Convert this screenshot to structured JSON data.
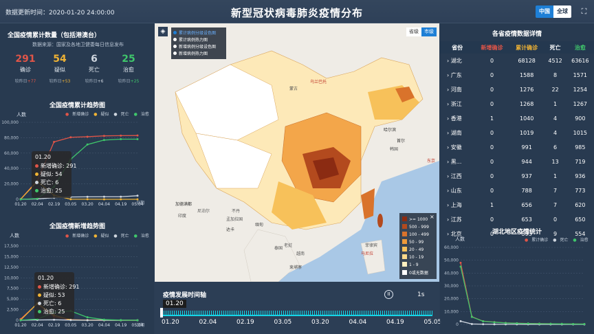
{
  "header": {
    "update_label": "数据更新时间：",
    "update_time": "2020-01-20 24:00:00",
    "title": "新型冠状病毒肺炎疫情分布",
    "btn_china": "中国",
    "btn_global": "全球",
    "colors": {
      "accent": "#1e7fd6"
    }
  },
  "left": {
    "summary_title": "全国疫情累计数量（包括港澳台）",
    "source": "数据来源：国家及各地卫健委每日信息发布",
    "stats": [
      {
        "value": "291",
        "label": "确诊",
        "delta_label": "较昨日",
        "delta": "+77",
        "color": "#e05548"
      },
      {
        "value": "54",
        "label": "疑似",
        "delta_label": "较昨日",
        "delta": "+53",
        "color": "#f0b334"
      },
      {
        "value": "6",
        "label": "死亡",
        "delta_label": "较昨日",
        "delta": "+6",
        "color": "#cfd6df"
      },
      {
        "value": "25",
        "label": "治愈",
        "delta_label": "较昨日",
        "delta": "+25",
        "color": "#3fc66b"
      }
    ],
    "trend1": {
      "title": "全国疫情累计趋势图",
      "ylabel": "人数",
      "xlabel": "日期"
    },
    "trend2": {
      "title": "全国疫情新增趋势图",
      "ylabel": "人数",
      "xlabel": "日期"
    },
    "legend": {
      "confirm": "新增确诊",
      "suspect": "疑似",
      "dead": "死亡",
      "cure": "治愈"
    },
    "tip1": {
      "date": "01.20",
      "confirm": "新增确诊: 291",
      "suspect": "疑似: 54",
      "dead": "死亡: 6",
      "cure": "治愈: 25"
    },
    "tip2": {
      "date": "01.20",
      "confirm": "新增确诊: 291",
      "suspect": "疑似: 53",
      "dead": "死亡: 6",
      "cure": "治愈: 25"
    }
  },
  "map": {
    "legend": [
      "累计病例分级设色图",
      "累计病例热力图",
      "新增病例分级设色图",
      "新增病例热力图"
    ],
    "btn_prov": "省级",
    "btn_city": "市级",
    "ranges": [
      ">= 1000",
      "500 - 999",
      "100 - 499",
      "50 - 99",
      "20 - 49",
      "10 - 19",
      "1 - 9",
      "0或无数据"
    ],
    "range_colors": [
      "#8b2b12",
      "#b34a1e",
      "#d9732b",
      "#ee9a3a",
      "#f7c15a",
      "#fbd98a",
      "#fdefc0",
      "#ffffff"
    ],
    "places": {
      "mongolia": "蒙古",
      "ulaanbaatar": "乌兰巴托",
      "korea": "韩国",
      "seoul": "首尔",
      "tokyo": "东京",
      "nepal": "尼泊尔",
      "india": "印度",
      "bangladesh": "孟加拉国",
      "myanmar": "缅甸",
      "thailand": "泰国",
      "vietnam": "越南",
      "laos": "老挝",
      "cambodia": "柬埔寨",
      "philippines": "菲律宾",
      "manila": "马尼拉",
      "bhutan": "不丹",
      "kathmandu": "加德满都",
      "dhaka": "达卡",
      "harbin": "哈尔滨"
    }
  },
  "timeline": {
    "title": "疫情发展时间轴",
    "speed": "1s",
    "current": "01.20",
    "ticks": [
      "01.20",
      "02.04",
      "02.19",
      "03.05",
      "03.20",
      "04.04",
      "04.19",
      "05.05"
    ]
  },
  "right": {
    "title": "各省疫情数据详情",
    "headers": [
      "省份",
      "新增确诊",
      "累计确诊",
      "死亡",
      "治愈"
    ],
    "header_colors": [
      "#ffffff",
      "#e05548",
      "#f0b334",
      "#ffffff",
      "#3fc66b"
    ],
    "rows": [
      [
        "湖北",
        "0",
        "68128",
        "4512",
        "63616"
      ],
      [
        "广东",
        "0",
        "1588",
        "8",
        "1571"
      ],
      [
        "河南",
        "0",
        "1276",
        "22",
        "1254"
      ],
      [
        "浙江",
        "0",
        "1268",
        "1",
        "1267"
      ],
      [
        "香港",
        "1",
        "1040",
        "4",
        "900"
      ],
      [
        "湖南",
        "0",
        "1019",
        "4",
        "1015"
      ],
      [
        "安徽",
        "0",
        "991",
        "6",
        "985"
      ],
      [
        "黑...",
        "0",
        "944",
        "13",
        "719"
      ],
      [
        "江西",
        "0",
        "937",
        "1",
        "936"
      ],
      [
        "山东",
        "0",
        "788",
        "7",
        "773"
      ],
      [
        "上海",
        "1",
        "656",
        "7",
        "620"
      ],
      [
        "江苏",
        "0",
        "653",
        "0",
        "650"
      ],
      [
        "北京",
        "0",
        "593",
        "9",
        "554"
      ]
    ],
    "hubei": {
      "title": "湖北地区疫情统计",
      "ylabel": "人数",
      "legend": {
        "confirm": "累计确诊",
        "dead": "死亡",
        "cure": "治愈"
      }
    }
  },
  "chart_data": [
    {
      "type": "line",
      "title": "全国疫情累计趋势图",
      "ylabel": "人数",
      "xlabel": "日期",
      "ylim": [
        0,
        100000
      ],
      "ticks_y": [
        "100,000",
        "80,000",
        "60,000",
        "40,000",
        "20,000",
        "0"
      ],
      "x": [
        "01.20",
        "02.04",
        "02.19",
        "03.05",
        "03.20",
        "04.04",
        "04.19",
        "05.04"
      ],
      "series": [
        {
          "name": "新增确诊",
          "values": [
            291,
            24324,
            74576,
            80566,
            81300,
            82400,
            82720,
            82880
          ],
          "color": "#e05548"
        },
        {
          "name": "疑似",
          "values": [
            54,
            23260,
            5248,
            143,
            100,
            20,
            10,
            5
          ],
          "color": "#f0b334"
        },
        {
          "name": "死亡",
          "values": [
            6,
            490,
            2118,
            3015,
            3255,
            3330,
            3340,
            4633
          ],
          "color": "#cfd6df"
        },
        {
          "name": "治愈",
          "values": [
            25,
            892,
            16157,
            52045,
            71150,
            76964,
            78100,
            78130
          ],
          "color": "#3fc66b"
        }
      ]
    },
    {
      "type": "line",
      "title": "全国疫情新增趋势图",
      "ylabel": "人数",
      "xlabel": "日期",
      "ylim": [
        0,
        17500
      ],
      "ticks_y": [
        "17,500",
        "15,000",
        "12,500",
        "10,000",
        "7,500",
        "5,000",
        "2,500",
        "0"
      ],
      "x": [
        "01.20",
        "02.04",
        "02.19",
        "03.05",
        "03.20",
        "04.04",
        "04.19",
        "05.04"
      ],
      "series": [
        {
          "name": "新增确诊",
          "values": [
            291,
            3887,
            820,
            143,
            41,
            30,
            25,
            2
          ],
          "color": "#e05548"
        },
        {
          "name": "疑似",
          "values": [
            53,
            3971,
            1185,
            102,
            30,
            10,
            5,
            0
          ],
          "color": "#f0b334"
        },
        {
          "name": "死亡",
          "values": [
            6,
            65,
            114,
            31,
            3,
            1,
            0,
            0
          ],
          "color": "#cfd6df"
        },
        {
          "name": "治愈",
          "values": [
            25,
            262,
            1824,
            2189,
            700,
            150,
            40,
            10
          ],
          "color": "#3fc66b"
        }
      ]
    },
    {
      "type": "line",
      "title": "湖北地区疫情统计",
      "ylabel": "人数",
      "ylim": [
        0,
        60000
      ],
      "ticks_y": [
        "60,000",
        "50,000",
        "40,000",
        "30,000",
        "20,000",
        "10,000",
        "0"
      ],
      "series": [
        {
          "name": "累计确诊",
          "values": [
            48000,
            6000,
            2500,
            1800,
            1200,
            900,
            700,
            600,
            500,
            400,
            300,
            250
          ],
          "color": "#e05548"
        },
        {
          "name": "死亡",
          "values": [
            2500,
            300,
            150,
            100,
            70,
            50,
            40,
            30,
            20,
            10,
            5,
            5
          ],
          "color": "#cfd6df"
        },
        {
          "name": "治愈",
          "values": [
            45000,
            5800,
            2400,
            1700,
            1100,
            850,
            650,
            550,
            450,
            380,
            290,
            240
          ],
          "color": "#3fc66b"
        }
      ]
    }
  ]
}
